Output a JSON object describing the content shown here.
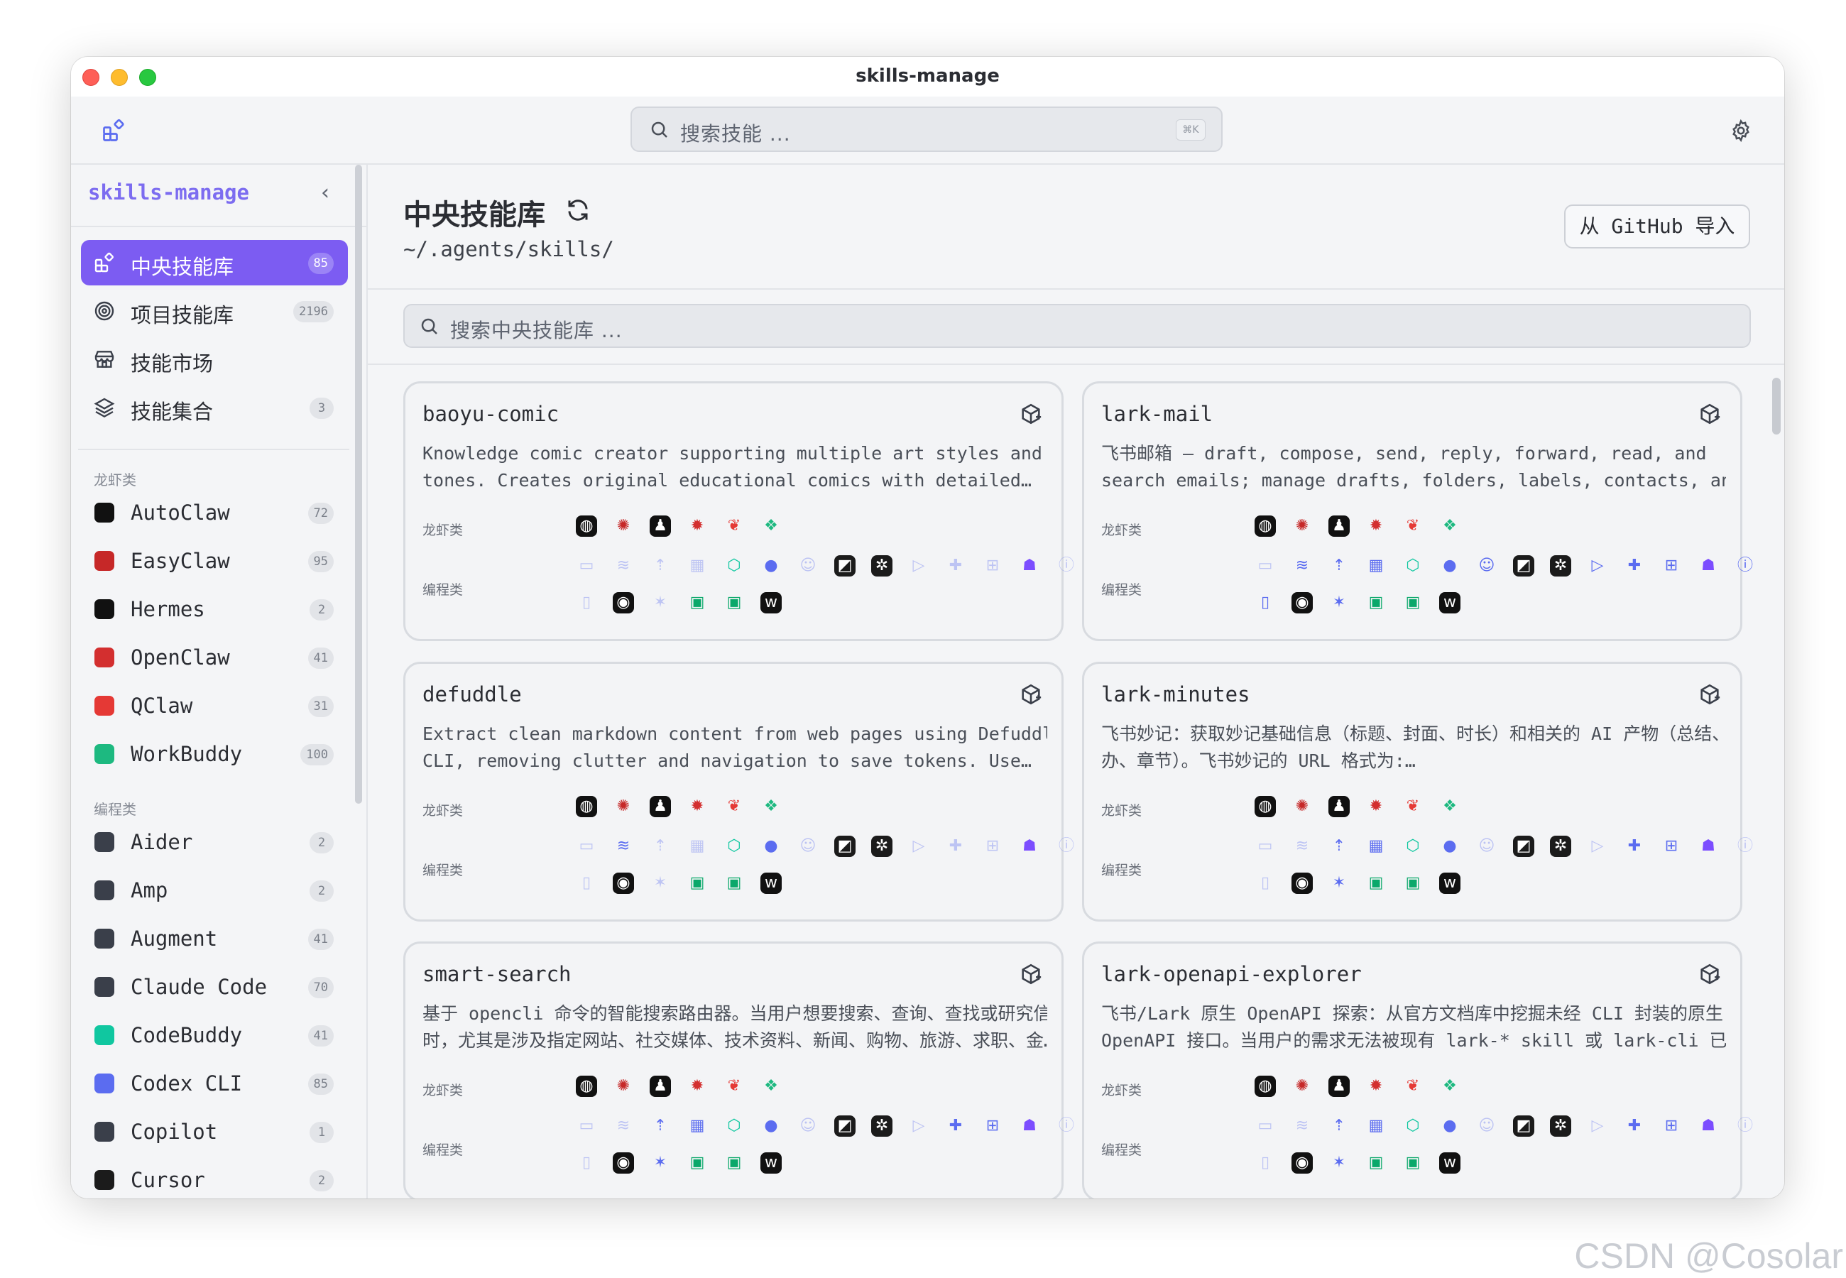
{
  "window": {
    "title": "skills-manage"
  },
  "toolbar": {
    "search_placeholder": "搜索技能 ...",
    "shortcut": "⌘K"
  },
  "sidebar": {
    "brand": "skills-manage",
    "collapse_glyph": "‹",
    "main_items": [
      {
        "label": "中央技能库",
        "count": "85",
        "icon": "grid-icon",
        "active": true
      },
      {
        "label": "项目技能库",
        "count": "2196",
        "icon": "target-icon"
      },
      {
        "label": "技能市场",
        "count": "",
        "icon": "store-icon"
      },
      {
        "label": "技能集合",
        "count": "3",
        "icon": "layers-icon"
      }
    ],
    "section_claw": "龙虾类",
    "claw_items": [
      {
        "label": "AutoClaw",
        "count": "72",
        "icon": "autoclaw-icon",
        "color": "#111111"
      },
      {
        "label": "EasyClaw",
        "count": "95",
        "icon": "easyclaw-icon",
        "color": "#c62828"
      },
      {
        "label": "Hermes",
        "count": "2",
        "icon": "hermes-icon",
        "color": "#111111"
      },
      {
        "label": "OpenClaw",
        "count": "41",
        "icon": "openclaw-icon",
        "color": "#d32f2f"
      },
      {
        "label": "QClaw",
        "count": "31",
        "icon": "qclaw-icon",
        "color": "#e53935"
      },
      {
        "label": "WorkBuddy",
        "count": "100",
        "icon": "workbuddy-icon",
        "color": "#1db980"
      }
    ],
    "section_code": "编程类",
    "code_items": [
      {
        "label": "Aider",
        "count": "2",
        "icon": "aider-icon",
        "color": "#3a3f4a"
      },
      {
        "label": "Amp",
        "count": "2",
        "icon": "amp-icon",
        "color": "#3a3f4a"
      },
      {
        "label": "Augment",
        "count": "41",
        "icon": "augment-icon",
        "color": "#3a3f4a"
      },
      {
        "label": "Claude Code",
        "count": "70",
        "icon": "claude-code-icon",
        "color": "#3a3f4a"
      },
      {
        "label": "CodeBuddy",
        "count": "41",
        "icon": "codebuddy-icon",
        "color": "#10c7a0"
      },
      {
        "label": "Codex CLI",
        "count": "85",
        "icon": "codex-icon",
        "color": "#5b6cf0"
      },
      {
        "label": "Copilot",
        "count": "1",
        "icon": "copilot-icon",
        "color": "#3a3f4a"
      },
      {
        "label": "Cursor",
        "count": "2",
        "icon": "cursor-icon",
        "color": "#1b1b1b"
      }
    ]
  },
  "main": {
    "title": "中央技能库",
    "path": "~/.agents/skills/",
    "import_label": "从 GitHub 导入",
    "search_placeholder": "搜索中央技能库 ...",
    "label_claw": "龙虾类",
    "label_code": "编程类"
  },
  "agents": {
    "claw": [
      {
        "name": "autoclaw",
        "icon": "autoclaw-icon",
        "color": "#111111",
        "glyph": "◍"
      },
      {
        "name": "easyclaw",
        "icon": "easyclaw-icon",
        "color": "#c62828",
        "glyph": "✺"
      },
      {
        "name": "hermes",
        "icon": "hermes-icon",
        "color": "#111111",
        "glyph": "♟"
      },
      {
        "name": "openclaw",
        "icon": "openclaw-icon",
        "color": "#d32f2f",
        "glyph": "✹"
      },
      {
        "name": "qclaw",
        "icon": "qclaw-icon",
        "color": "#e53935",
        "glyph": "❦"
      },
      {
        "name": "workbuddy",
        "icon": "workbuddy-icon",
        "color": "#1db980",
        "glyph": "❖"
      }
    ],
    "code": [
      {
        "name": "aider",
        "icon": "aider-icon",
        "color": "#5b6cf0",
        "glyph": "▭"
      },
      {
        "name": "amp",
        "icon": "amp-icon",
        "color": "#5b6cf0",
        "glyph": "≋"
      },
      {
        "name": "augment",
        "icon": "augment-icon",
        "color": "#5b6cf0",
        "glyph": "⇡"
      },
      {
        "name": "claude-code",
        "icon": "claude-code-icon",
        "color": "#5b6cf0",
        "glyph": "▦"
      },
      {
        "name": "codebuddy",
        "icon": "codebuddy-icon",
        "color": "#10c7a0",
        "glyph": "⬡"
      },
      {
        "name": "codex",
        "icon": "codex-icon",
        "color": "#5b6cf0",
        "glyph": "●"
      },
      {
        "name": "copilot",
        "icon": "copilot-icon",
        "color": "#5b6cf0",
        "glyph": "☺"
      },
      {
        "name": "cursor",
        "icon": "cursor-icon",
        "color": "#1b1b1b",
        "glyph": "◩"
      },
      {
        "name": "cline",
        "icon": "cline-icon",
        "color": "#1b1b1b",
        "glyph": "✲"
      },
      {
        "name": "terminal",
        "icon": "terminal-icon",
        "color": "#5b6cf0",
        "glyph": "▷"
      },
      {
        "name": "gemini",
        "icon": "gemini-icon",
        "color": "#5b6cf0",
        "glyph": "✚"
      },
      {
        "name": "kiro",
        "icon": "kiro-icon",
        "color": "#5b6cf0",
        "glyph": "⊞"
      },
      {
        "name": "kilo",
        "icon": "kilo-icon",
        "color": "#7c4dff",
        "glyph": "☗"
      },
      {
        "name": "info",
        "icon": "info-icon",
        "color": "#5b6cf0",
        "glyph": "ⓘ"
      },
      {
        "name": "opencode",
        "icon": "opencode-icon",
        "color": "#5b6cf0",
        "glyph": "▯"
      },
      {
        "name": "qoder",
        "icon": "qoder-icon",
        "color": "#111111",
        "glyph": "◉"
      },
      {
        "name": "roo",
        "icon": "roo-icon",
        "color": "#5b6cf0",
        "glyph": "✶"
      },
      {
        "name": "trae",
        "icon": "trae-icon",
        "color": "#0aa86a",
        "glyph": "▣"
      },
      {
        "name": "trae-cn",
        "icon": "trae-cn-icon",
        "color": "#0aa86a",
        "glyph": "▣"
      },
      {
        "name": "windsurf",
        "icon": "windsurf-icon",
        "color": "#111111",
        "glyph": "w"
      }
    ]
  },
  "cards": [
    {
      "title": "baoyu-comic",
      "desc": [
        "Knowledge comic creator supporting multiple art styles and",
        "tones. Creates original educational comics with detailed…"
      ],
      "code_active": [
        false,
        false,
        false,
        false,
        true,
        true,
        false,
        true,
        true,
        false,
        false,
        false,
        true,
        false,
        false,
        true,
        false,
        true,
        true,
        true
      ]
    },
    {
      "title": "lark-mail",
      "desc": [
        "飞书邮箱 — draft, compose, send, reply, forward, read, and",
        "search emails; manage drafts, folders, labels, contacts, an…"
      ],
      "code_active": [
        false,
        true,
        true,
        true,
        true,
        true,
        true,
        true,
        true,
        true,
        true,
        true,
        true,
        true,
        true,
        true,
        true,
        true,
        true,
        true
      ]
    },
    {
      "title": "defuddle",
      "desc": [
        "Extract clean markdown content from web pages using Defuddle",
        "CLI, removing clutter and navigation to save tokens. Use…"
      ],
      "code_active": [
        false,
        true,
        false,
        false,
        true,
        true,
        false,
        true,
        true,
        false,
        false,
        false,
        true,
        false,
        false,
        true,
        false,
        true,
        true,
        true
      ]
    },
    {
      "title": "lark-minutes",
      "desc": [
        "飞书妙记：获取妙记基础信息（标题、封面、时长）和相关的 AI 产物（总结、待",
        "办、章节）。飞书妙记的 URL 格式为:…"
      ],
      "code_active": [
        false,
        false,
        true,
        true,
        true,
        true,
        false,
        true,
        true,
        false,
        true,
        true,
        true,
        false,
        false,
        true,
        true,
        true,
        true,
        true
      ]
    },
    {
      "title": "smart-search",
      "desc": [
        "基于 opencli 命令的智能搜索路由器。当用户想要搜索、查询、查找或研究信息",
        "时，尤其是涉及指定网站、社交媒体、技术资料、新闻、购物、旅游、求职、金…"
      ],
      "code_active": [
        false,
        false,
        true,
        true,
        true,
        true,
        false,
        true,
        true,
        false,
        true,
        true,
        true,
        false,
        false,
        true,
        true,
        true,
        true,
        true
      ]
    },
    {
      "title": "lark-openapi-explorer",
      "desc": [
        "飞书/Lark 原生 OpenAPI 探索：从官方文档库中挖掘未经 CLI 封装的原生",
        "OpenAPI 接口。当用户的需求无法被现有 lark-* skill 或 lark-cli 已…"
      ],
      "code_active": [
        false,
        false,
        true,
        true,
        true,
        true,
        false,
        true,
        true,
        false,
        true,
        true,
        true,
        false,
        false,
        true,
        true,
        true,
        true,
        true
      ]
    }
  ],
  "watermark": "CSDN @Cosolar"
}
